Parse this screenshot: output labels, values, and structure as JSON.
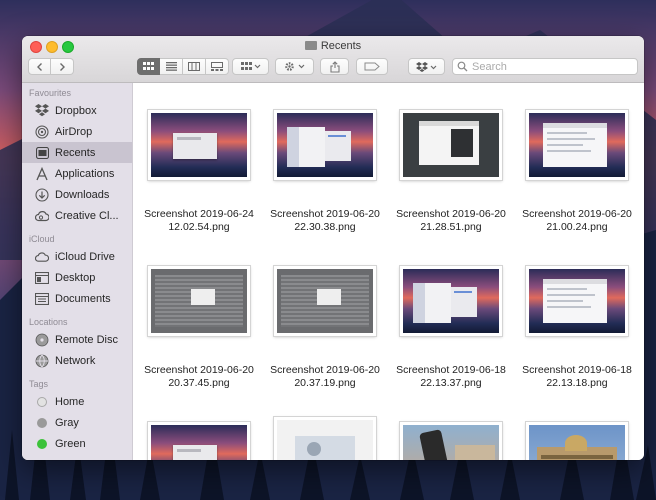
{
  "window": {
    "title": "Recents"
  },
  "toolbar": {
    "search_placeholder": "Search",
    "view_modes": [
      "icon-view",
      "list-view",
      "column-view",
      "gallery-view"
    ]
  },
  "sidebar": {
    "favourites_header": "Favourites",
    "favourites": [
      {
        "label": "Dropbox",
        "icon": "dropbox-icon"
      },
      {
        "label": "AirDrop",
        "icon": "airdrop-icon"
      },
      {
        "label": "Recents",
        "icon": "recents-icon",
        "selected": true
      },
      {
        "label": "Applications",
        "icon": "applications-icon"
      },
      {
        "label": "Downloads",
        "icon": "downloads-icon"
      },
      {
        "label": "Creative Cl...",
        "icon": "creative-cloud-icon"
      }
    ],
    "icloud_header": "iCloud",
    "icloud": [
      {
        "label": "iCloud Drive",
        "icon": "icloud-icon"
      },
      {
        "label": "Desktop",
        "icon": "desktop-icon"
      },
      {
        "label": "Documents",
        "icon": "documents-icon"
      }
    ],
    "locations_header": "Locations",
    "locations": [
      {
        "label": "Remote Disc",
        "icon": "disc-icon"
      },
      {
        "label": "Network",
        "icon": "network-icon"
      }
    ],
    "tags_header": "Tags",
    "tags": [
      {
        "label": "Home",
        "color": "#e2e2e2"
      },
      {
        "label": "Gray",
        "color": "#9a9a9a"
      },
      {
        "label": "Green",
        "color": "#3cc23a"
      }
    ]
  },
  "files": [
    {
      "line1": "Screenshot 2019-06-24",
      "line2": "12.02.54.png",
      "thumb": "sunset-dialog"
    },
    {
      "line1": "Screenshot 2019-06-20",
      "line2": "22.30.38.png",
      "thumb": "sunset-window"
    },
    {
      "line1": "Screenshot 2019-06-20",
      "line2": "21.28.51.png",
      "thumb": "dark-window"
    },
    {
      "line1": "Screenshot 2019-06-20",
      "line2": "21.00.24.png",
      "thumb": "sunset-list"
    },
    {
      "line1": "Screenshot 2019-06-20",
      "line2": "20.37.45.png",
      "thumb": "gray-table"
    },
    {
      "line1": "Screenshot 2019-06-20",
      "line2": "20.37.19.png",
      "thumb": "gray-table"
    },
    {
      "line1": "Screenshot 2019-06-18",
      "line2": "22.13.37.png",
      "thumb": "sunset-window"
    },
    {
      "line1": "Screenshot 2019-06-18",
      "line2": "22.13.18.png",
      "thumb": "sunset-list"
    },
    {
      "line1": "",
      "line2": "",
      "thumb": "sunset-dialog"
    },
    {
      "line1": "",
      "line2": "",
      "thumb": "light-doc"
    },
    {
      "line1": "",
      "line2": "",
      "thumb": "photo-phone"
    },
    {
      "line1": "",
      "line2": "",
      "thumb": "photo-building"
    }
  ]
}
